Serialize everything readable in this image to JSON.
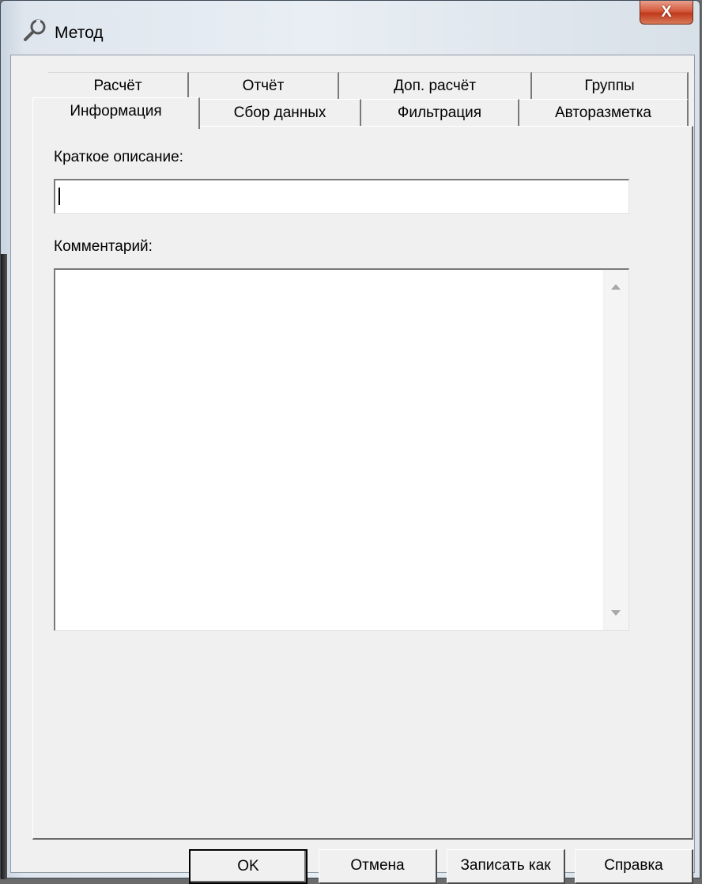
{
  "window": {
    "title": "Метод",
    "close_label": "X"
  },
  "tabs": {
    "row1": [
      "Расчёт",
      "Отчёт",
      "Доп. расчёт",
      "Группы"
    ],
    "row2": [
      "Информация",
      "Сбор данных",
      "Фильтрация",
      "Авторазметка"
    ],
    "active": "Информация"
  },
  "form": {
    "short_description_label": "Краткое описание:",
    "short_description_value": "",
    "comment_label": "Комментарий:",
    "comment_value": ""
  },
  "buttons": {
    "ok": "OK",
    "cancel": "Отмена",
    "save_as": "Записать как",
    "help": "Справка"
  }
}
